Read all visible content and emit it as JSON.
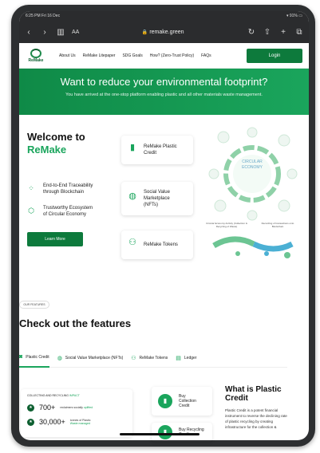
{
  "status_bar": {
    "time": "6:25 PM  Fri 16 Dec",
    "battery": "91%"
  },
  "browser": {
    "aa": "AA",
    "url": "remake.green",
    "icons": [
      "back-icon",
      "forward-icon",
      "book-icon",
      "reload-icon",
      "share-icon",
      "plus-icon",
      "tabs-icon"
    ]
  },
  "nav": {
    "logo_text": "ReMake",
    "links": [
      "About Us",
      "ReMake Litepaper",
      "SDG Goals",
      "How? (Zero-Trust Policy)",
      "FAQs"
    ],
    "login": "Login"
  },
  "hero": {
    "title": "Want to reduce your environmental footprint?",
    "subtitle": "You have arrived at the one-stop platform enabling plastic and all other materials waste management."
  },
  "welcome": {
    "title_line1": "Welcome to",
    "title_line2": "ReMake",
    "features": [
      {
        "text_line1": "End-to-End Traceability",
        "text_line2": "through Blockchain",
        "icon": "network-icon"
      },
      {
        "text_line1": "Trustworthy Ecosystem",
        "text_line2": "of Circular Economy",
        "icon": "cube-icon"
      }
    ],
    "learn_more": "Learn More",
    "cards": [
      {
        "line1": "ReMake Plastic",
        "line2": "Credit",
        "line3": "",
        "icon": "bottle-icon"
      },
      {
        "line1": "Social Value",
        "line2": "Marketplace",
        "line3": "(NFTs)",
        "icon": "globe-icon"
      },
      {
        "line1": "ReMake Tokens",
        "line2": "",
        "line3": "",
        "icon": "tokens-icon"
      }
    ],
    "diagram": {
      "center": "CIRCULAR ECONOMY",
      "caption_left": "Circular Economy Activity (Collection & Recycling of Waste)",
      "caption_right": "Recording of transactions onto Blockchain"
    }
  },
  "features": {
    "tag": "OUR FEATURES",
    "title": "Check out the features",
    "tabs": [
      "Plastic Credit",
      "Social Value Marketplace (NFTs)",
      "ReMake Tokens",
      "Ledger"
    ],
    "impact": {
      "heading_a": "COLLECTING AND RECYCLING",
      "heading_b": "IMPACT",
      "stats": [
        {
          "number": "700+",
          "desc_a": "reclaimers socially",
          "desc_b": "uplifted"
        },
        {
          "number": "30,000+",
          "desc_a": "tonnes of Plastic",
          "desc_b": "Waste managed"
        }
      ]
    },
    "pc_cards": [
      {
        "line1": "Buy",
        "line2": "Collection",
        "line3": "Credit"
      },
      {
        "line1": "Buy Recycling",
        "line2": "Credit",
        "line3": ""
      }
    ],
    "pc_title": "What is Plastic Credit",
    "pc_desc": "Plastic Credit is a potent financial instrument to reverse the declining rate of plastic recycling by creating infrastructure for the collection &"
  },
  "colors": {
    "brand": "#1aa55c",
    "brand_dark": "#0d7a3c"
  }
}
